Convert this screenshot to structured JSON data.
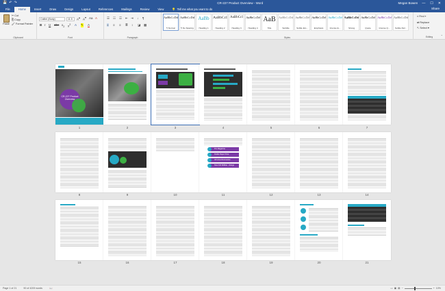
{
  "titlebar": {
    "title": "CR-227 Product Overview - Word",
    "user": "Megan Bowen",
    "save_icon": "save-icon",
    "undo_icon": "undo-icon",
    "redo_icon": "redo-icon",
    "min": "—",
    "max": "☐",
    "close": "✕"
  },
  "tabs": [
    "File",
    "Home",
    "Insert",
    "Draw",
    "Design",
    "Layout",
    "References",
    "Mailings",
    "Review",
    "View"
  ],
  "active_tab": "Home",
  "tell_me": "Tell me what you want to do",
  "share": "Share",
  "clipboard": {
    "paste": "Paste",
    "cut": "Cut",
    "copy": "Copy",
    "format_painter": "Format Painter",
    "label": "Clipboard"
  },
  "font": {
    "name": "Calibri (Body)",
    "size": "11.5",
    "label": "Font"
  },
  "paragraph": {
    "label": "Paragraph"
  },
  "styles": {
    "label": "Styles",
    "items": [
      {
        "sample": "AaBbCcDd",
        "name": "¶ Normal"
      },
      {
        "sample": "AaBbCcDd",
        "name": "¶ No Spacing"
      },
      {
        "sample": "AaBb",
        "name": "Heading 1"
      },
      {
        "sample": "AaBbCcI",
        "name": "Heading 2"
      },
      {
        "sample": "AaBbCcI",
        "name": "Heading 3"
      },
      {
        "sample": "AaBbCcDd",
        "name": "Heading 4"
      },
      {
        "sample": "AaB",
        "name": "Title"
      },
      {
        "sample": "AaBbCcDd",
        "name": "Subtitle"
      },
      {
        "sample": "AaBbCcDd",
        "name": "Subtle Em..."
      },
      {
        "sample": "AaBbCcDd",
        "name": "Emphasis"
      },
      {
        "sample": "AaBbCcDd",
        "name": "Intense E..."
      },
      {
        "sample": "AaBbCcDd",
        "name": "Strong"
      },
      {
        "sample": "AaBbCcDd",
        "name": "Quote"
      },
      {
        "sample": "AaBbCcDd",
        "name": "Intense Q..."
      },
      {
        "sample": "AaBbCcDd",
        "name": "Subtle Ref..."
      }
    ]
  },
  "editing": {
    "find": "Find",
    "replace": "Replace",
    "select": "Select",
    "label": "Editing"
  },
  "pages": [
    "1",
    "2",
    "3",
    "4",
    "5",
    "6",
    "7",
    "8",
    "9",
    "10",
    "11",
    "12",
    "13",
    "14",
    "15",
    "16",
    "17",
    "18",
    "19",
    "20",
    "21"
  ],
  "page1": {
    "title": "CR-227 Product Overview"
  },
  "page11_items": [
    "Pro Magazine",
    "Kindle Paper Price",
    "All Lines Recoveries",
    "Now 100 Millibar - Range"
  ],
  "status": {
    "page": "Page 1 of 21",
    "words": "90 of 4209 words",
    "zoom": "10%"
  },
  "colors": {
    "accent": "#2b579a",
    "teal": "#27a9c5",
    "purple": "#7b3aa6",
    "green": "#3cb043"
  }
}
